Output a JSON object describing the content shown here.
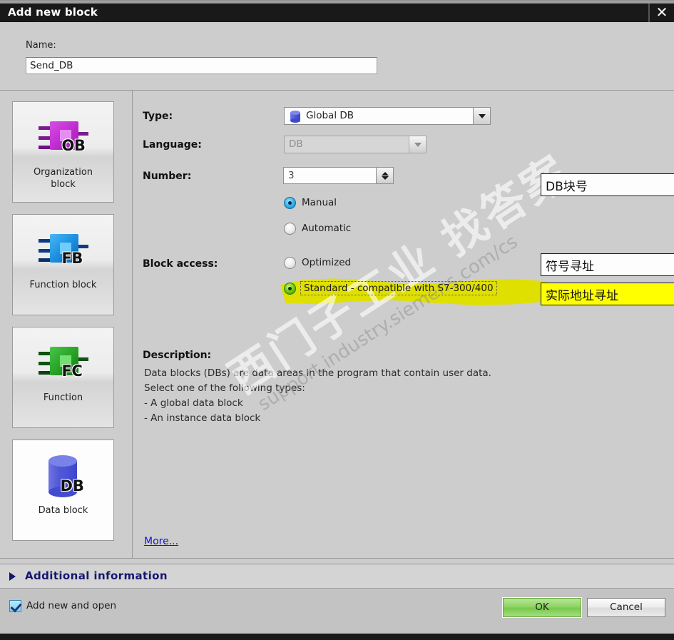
{
  "window": {
    "title": "Add new block",
    "close_icon": "close-icon"
  },
  "name_section": {
    "label": "Name:",
    "value": "Send_DB"
  },
  "block_types": [
    {
      "label_line1": "Organization",
      "label_line2": "block",
      "tag": "OB",
      "color": "#c12fd0",
      "selected": false
    },
    {
      "label_line1": "Function block",
      "label_line2": "",
      "tag": "FB",
      "color": "#1d8fe0",
      "selected": false
    },
    {
      "label_line1": "Function",
      "label_line2": "",
      "tag": "FC",
      "color": "#28a428",
      "selected": false
    },
    {
      "label_line1": "Data block",
      "label_line2": "",
      "tag": "DB",
      "color": "#4a53d4",
      "selected": true
    }
  ],
  "form": {
    "type": {
      "label": "Type:",
      "value": "Global DB",
      "icon": "db-cylinder-icon"
    },
    "language": {
      "label": "Language:",
      "value": "DB",
      "disabled": true
    },
    "number": {
      "label": "Number:",
      "value": "3"
    },
    "number_mode": {
      "manual": "Manual",
      "automatic": "Automatic",
      "selected": "Manual"
    },
    "block_access": {
      "label": "Block access:",
      "optimized": "Optimized",
      "standard": "Standard - compatible with S7-300/400",
      "selected": "Standard - compatible with S7-300/400"
    },
    "description": {
      "title": "Description:",
      "lines": [
        "Data blocks (DBs) are data areas in the program that contain user data.",
        "Select one of the following types:",
        "- A global data block",
        "- An instance data block"
      ]
    },
    "more_link": "More..."
  },
  "annotations": [
    {
      "text": "DB块号",
      "highlighted": false
    },
    {
      "text": "符号寻址",
      "highlighted": false
    },
    {
      "text": "实际地址寻址",
      "highlighted": true
    }
  ],
  "additional_information": {
    "label": "Additional  information",
    "expander_icon": "chevron-right-icon"
  },
  "footer": {
    "checkbox_label": "Add new and open",
    "checkbox_checked": true,
    "ok_label": "OK",
    "cancel_label": "Cancel"
  },
  "watermark": {
    "chinese": "西门子工业 找答案",
    "english": "support.industry.siemens.com/cs"
  },
  "colors": {
    "accent_green": "#7ed321",
    "accent_blue": "#3fb6ea",
    "highlight_yellow": "#ffff00",
    "highlighter": "#e0e000",
    "link": "#1414dd",
    "titlebar": "#191919",
    "dialog_bg": "#cdcdcd"
  }
}
